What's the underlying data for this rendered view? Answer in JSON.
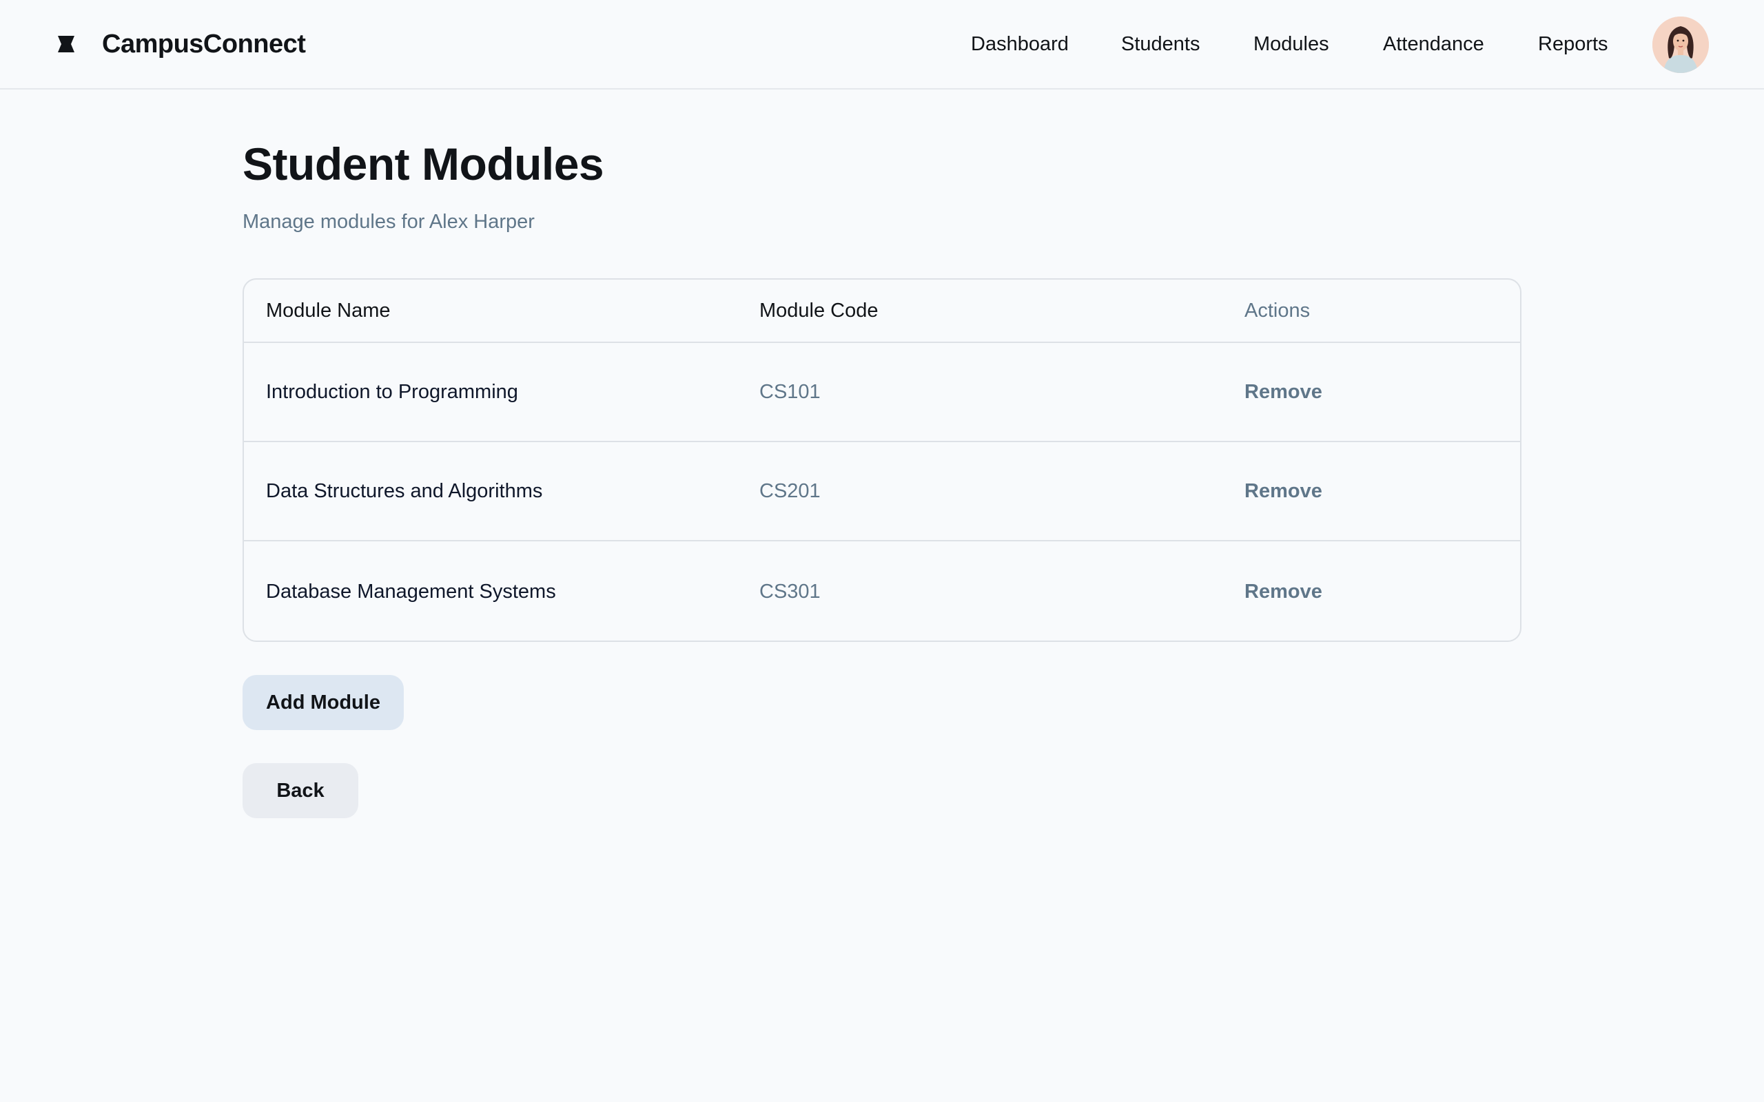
{
  "header": {
    "brand_name": "CampusConnect",
    "brand_icon": "campus-logo-icon",
    "nav": [
      {
        "label": "Dashboard"
      },
      {
        "label": "Students"
      },
      {
        "label": "Modules"
      },
      {
        "label": "Attendance"
      },
      {
        "label": "Reports"
      }
    ],
    "avatar_icon": "user-avatar"
  },
  "page": {
    "title": "Student Modules",
    "subtitle": "Manage modules for Alex Harper"
  },
  "table": {
    "columns": [
      "Module Name",
      "Module Code",
      "Actions"
    ],
    "rows": [
      {
        "name": "Introduction to Programming",
        "code": "CS101",
        "action": "Remove"
      },
      {
        "name": "Data Structures and Algorithms",
        "code": "CS201",
        "action": "Remove"
      },
      {
        "name": "Database Management Systems",
        "code": "CS301",
        "action": "Remove"
      }
    ]
  },
  "buttons": {
    "add_module": "Add Module",
    "back": "Back"
  },
  "colors": {
    "background": "#f8fafc",
    "text": "#111418",
    "muted": "#5f7689",
    "border": "#dde1e6",
    "add_button_bg": "#dde7f2",
    "back_button_bg": "#e9ecf1"
  }
}
